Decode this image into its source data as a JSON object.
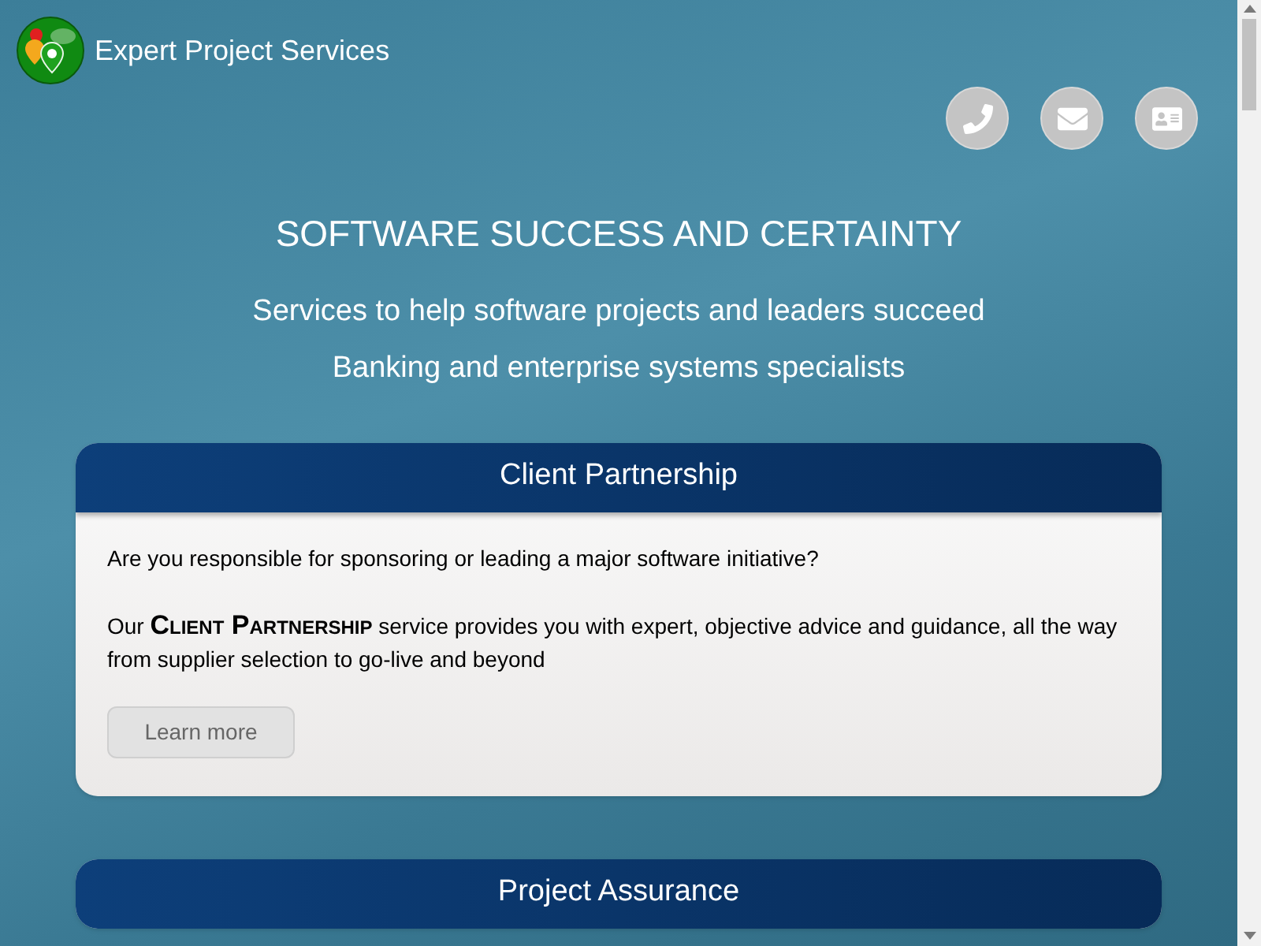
{
  "brand": {
    "name": "Expert Project Services"
  },
  "contact_buttons": [
    {
      "kind": "phone"
    },
    {
      "kind": "email"
    },
    {
      "kind": "card"
    }
  ],
  "hero": {
    "headline": "SOFTWARE SUCCESS AND CERTAINTY",
    "lines": [
      "Services to help software projects and leaders succeed",
      "Banking and enterprise systems specialists"
    ]
  },
  "cards": [
    {
      "title": "Client Partnership",
      "paragraphs": [
        "Are you responsible for sponsoring or leading a major software initiative?",
        "Our **Client Partnership** service provides you with expert, objective advice and guidance, all the way from supplier selection to go-live and beyond"
      ],
      "button": "Learn more"
    },
    {
      "title": "Project Assurance"
    }
  ]
}
